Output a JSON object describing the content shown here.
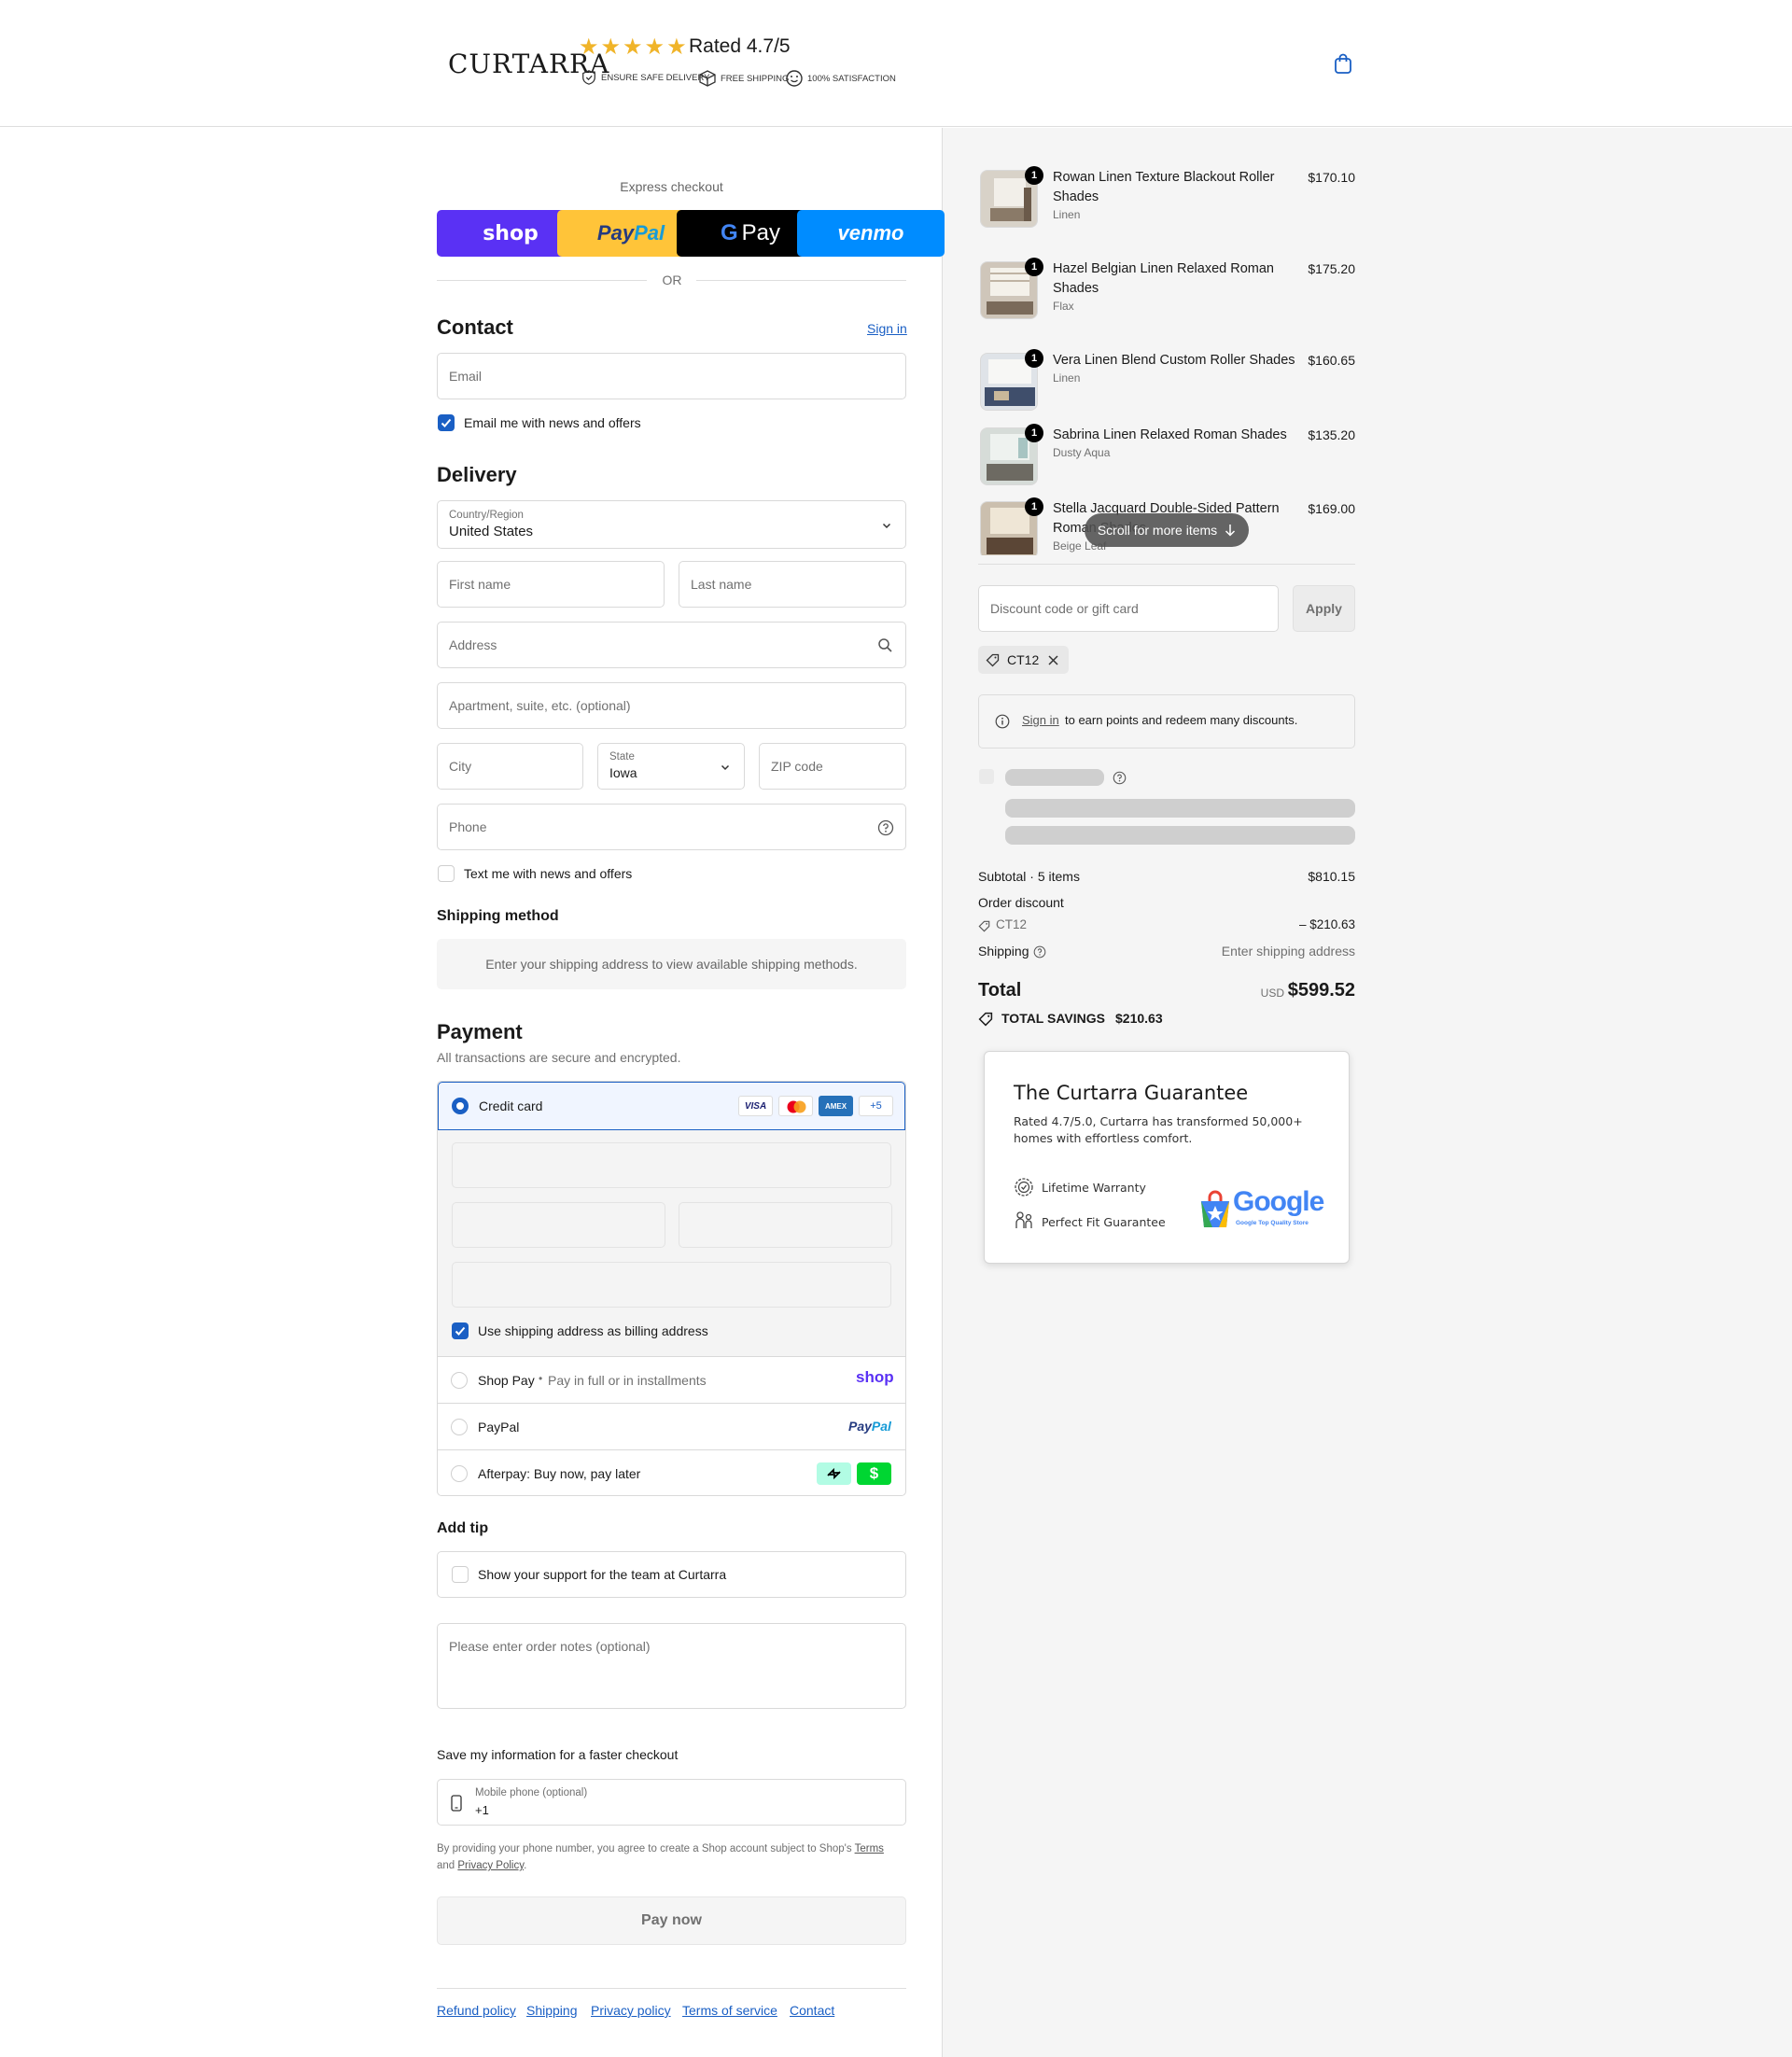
{
  "header": {
    "logo": "CURTARRA",
    "stars": "★★★★★",
    "rating": "Rated 4.7/5",
    "badges": [
      "ENSURE SAFE DELIVERY",
      "FREE SHIPPING",
      "100% SATISFACTION"
    ]
  },
  "express": {
    "title": "Express checkout",
    "shop": "shop",
    "paypal_a": "Pay",
    "paypal_b": "Pal",
    "gpay_g": "G",
    "gpay": "Pay",
    "venmo": "venmo",
    "or": "OR"
  },
  "contact": {
    "title": "Contact",
    "sign_in": "Sign in",
    "email_placeholder": "Email",
    "newsletter": "Email me with news and offers"
  },
  "delivery": {
    "title": "Delivery",
    "country_label": "Country/Region",
    "country": "United States",
    "first_name": "First name",
    "last_name": "Last name",
    "address": "Address",
    "apartment": "Apartment, suite, etc. (optional)",
    "city": "City",
    "state_label": "State",
    "state": "Iowa",
    "zip": "ZIP code",
    "phone": "Phone",
    "sms": "Text me with news and offers"
  },
  "shipping": {
    "title": "Shipping method",
    "notice": "Enter your shipping address to view available shipping methods."
  },
  "payment": {
    "title": "Payment",
    "subtitle": "All transactions are secure and encrypted.",
    "credit_card": "Credit card",
    "cards": [
      "VISA",
      "AMEX",
      "+5"
    ],
    "billing": "Use shipping address as billing address",
    "shop_pay": "Shop Pay",
    "shop_pay_desc": "Pay in full or in installments",
    "shop_logo": "shop",
    "paypal": "PayPal",
    "paypal_logo_a": "Pay",
    "paypal_logo_b": "Pal",
    "afterpay": "Afterpay: Buy now, pay later",
    "cashapp": "$"
  },
  "tip": {
    "title": "Add tip",
    "support": "Show your support for the team at Curtarra"
  },
  "notes": {
    "placeholder": "Please enter order notes (optional)"
  },
  "save_info": {
    "title": "Save my information for a faster checkout",
    "mobile_label": "Mobile phone (optional)",
    "mobile_value": "+1",
    "legal_a": "By providing your phone number, you agree to create a Shop account subject to Shop's",
    "terms": "Terms",
    "and": "and",
    "privacy": "Privacy Policy",
    "dot": "."
  },
  "pay_now": "Pay now",
  "footer": [
    "Refund policy",
    "Shipping",
    "Privacy policy",
    "Terms of service",
    "Contact"
  ],
  "order": {
    "items": [
      {
        "qty": "1",
        "name": "Rowan Linen Texture Blackout Roller Shades",
        "variant": "Linen",
        "price": "$170.10"
      },
      {
        "qty": "1",
        "name": "Hazel Belgian Linen Relaxed Roman Shades",
        "variant": "Flax",
        "price": "$175.20"
      },
      {
        "qty": "1",
        "name": "Vera Linen Blend Custom Roller Shades",
        "variant": "Linen",
        "price": "$160.65"
      },
      {
        "qty": "1",
        "name": "Sabrina Linen Relaxed Roman Shades",
        "variant": "Dusty Aqua",
        "price": "$135.20"
      },
      {
        "qty": "1",
        "name": "Stella Jacquard Double-Sided Pattern Roman Shades",
        "variant": "Beige Leaf",
        "price": "$169.00"
      }
    ],
    "scroll_hint": "Scroll for more items",
    "discount_placeholder": "Discount code or gift card",
    "apply": "Apply",
    "code": "CT12",
    "signin_link": "Sign in",
    "signin_text": "to earn points and redeem many discounts.",
    "subtotal_label": "Subtotal · 5 items",
    "subtotal": "$810.15",
    "order_discount": "Order discount",
    "discount_code": "CT12",
    "discount_amount": "– $210.63",
    "shipping_label": "Shipping",
    "shipping_value": "Enter shipping address",
    "total_label": "Total",
    "currency": "USD",
    "total": "$599.52",
    "savings_label": "TOTAL SAVINGS",
    "savings": "$210.63"
  },
  "guarantee": {
    "title": "The Curtarra Guarantee",
    "text": "Rated 4.7/5.0, Curtarra has transformed 50,000+ homes with effortless comfort.",
    "lifetime": "Lifetime Warranty",
    "fit": "Perfect Fit Guarantee",
    "google": "Google",
    "google_sub": "Google Top Quality Store"
  },
  "colors": {
    "accent": "#1a5fc4",
    "shop_purple": "#5a31f4",
    "paypal_yellow": "#ffc439",
    "venmo_blue": "#008cff",
    "star": "#f0b429"
  }
}
